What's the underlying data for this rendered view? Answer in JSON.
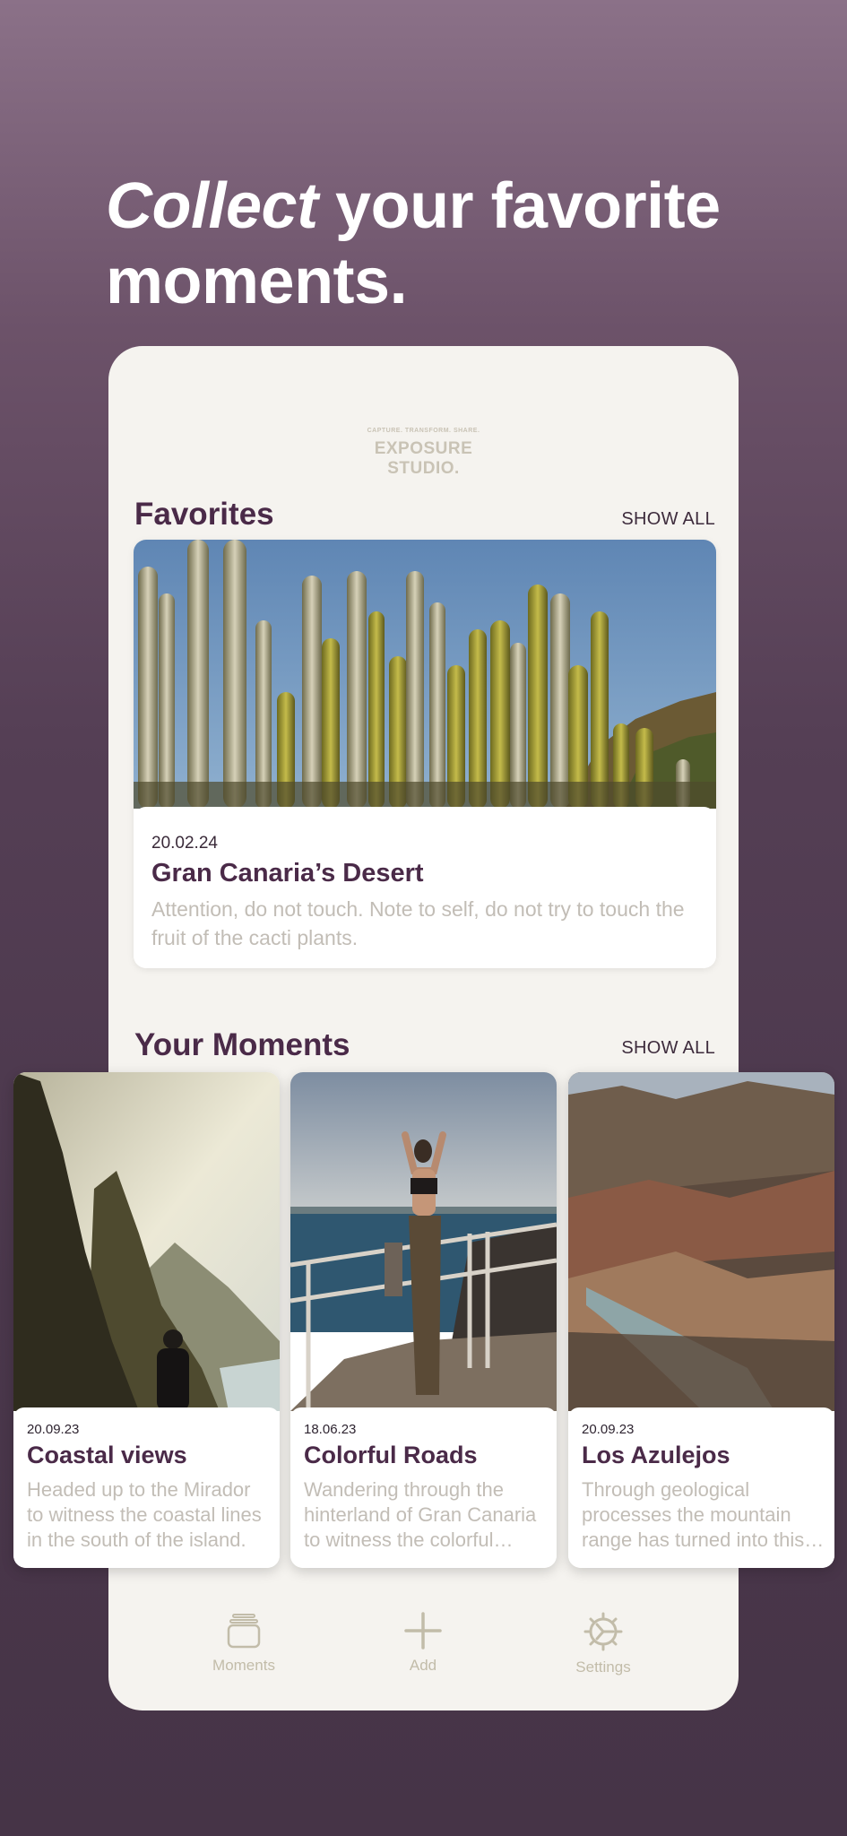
{
  "headline": {
    "emphasis": "Collect",
    "rest": " your favorite moments."
  },
  "brand": {
    "tagline": "CAPTURE. TRANSFORM. SHARE.",
    "line1": "EXPOSURE",
    "line2": "STUDIO."
  },
  "favorites": {
    "title": "Favorites",
    "show_all": "SHOW ALL",
    "card": {
      "date": "20.02.24",
      "title": "Gran Canaria’s Desert",
      "description": "Attention, do not touch. Note to self, do not try to touch the fruit of the cacti plants."
    }
  },
  "moments": {
    "title": "Your Moments",
    "show_all": "SHOW ALL",
    "items": [
      {
        "date": "20.09.23",
        "title": "Coastal views",
        "description": "Headed up to the Mirador to witness the coastal lines in the south of the island."
      },
      {
        "date": "18.06.23",
        "title": "Colorful Roads",
        "description": "Wandering through the hinterland of Gran Canaria to witness the colorful roads."
      },
      {
        "date": "20.09.23",
        "title": "Los Azulejos",
        "description": "Through geological processes the mountain range has turned into this colorful spectacle."
      }
    ]
  },
  "nav": {
    "moments": "Moments",
    "add": "Add",
    "settings": "Settings"
  },
  "icons": {
    "moments": "stacked-cards-icon",
    "add": "plus-icon",
    "settings": "gear-icon"
  },
  "colors": {
    "accent": "#4a2a48",
    "muted": "#c2bdb6",
    "surface": "#f5f3ef",
    "background": "#553f55"
  }
}
